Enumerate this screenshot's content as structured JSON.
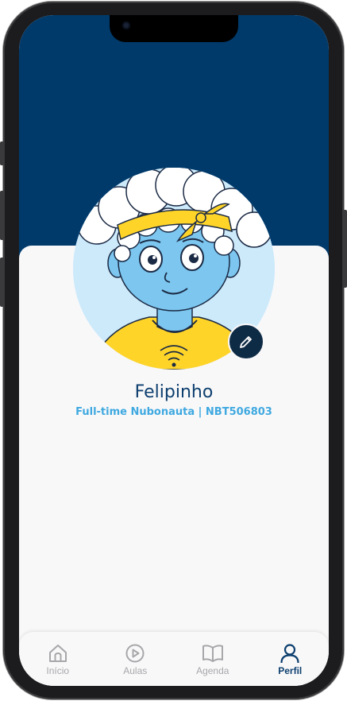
{
  "profile": {
    "name": "Felipinho",
    "subtitle": "Full-time Nubonauta | NBT506803",
    "edit_icon": "pencil-icon"
  },
  "tabbar": {
    "tabs": [
      {
        "label": "Início",
        "icon": "home-icon",
        "active": false
      },
      {
        "label": "Aulas",
        "icon": "play-circle-icon",
        "active": false
      },
      {
        "label": "Agenda",
        "icon": "book-icon",
        "active": false
      },
      {
        "label": "Perfil",
        "icon": "user-icon",
        "active": true
      }
    ]
  },
  "colors": {
    "header": "#003a6b",
    "accent": "#3fa9e0",
    "name": "#0d3f6e",
    "tab_inactive": "#a7a7aa",
    "tab_active": "#0d3f6e"
  }
}
